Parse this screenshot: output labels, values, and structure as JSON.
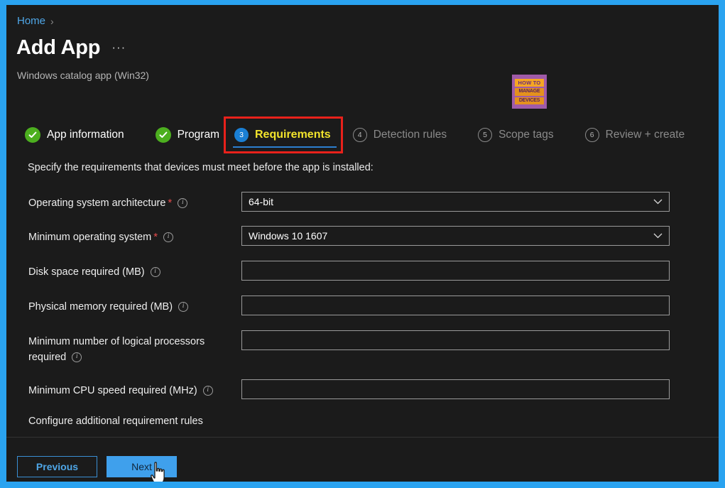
{
  "window": {
    "accent_border_color": "#2aa3f0",
    "background_color": "#1b1b1b"
  },
  "breadcrumb": {
    "home_label": "Home",
    "separator": "›"
  },
  "header": {
    "title": "Add App",
    "ellipsis": "···",
    "subtitle": "Windows catalog app (Win32)"
  },
  "watermark": {
    "line1": "HOW TO",
    "line2": "MANAGE",
    "line3": "DEVICES"
  },
  "wizard": {
    "tabs": [
      {
        "number": "1",
        "label": "App information",
        "state": "done"
      },
      {
        "number": "2",
        "label": "Program",
        "state": "done"
      },
      {
        "number": "3",
        "label": "Requirements",
        "state": "active"
      },
      {
        "number": "4",
        "label": "Detection rules",
        "state": "upcoming"
      },
      {
        "number": "5",
        "label": "Scope tags",
        "state": "upcoming"
      },
      {
        "number": "6",
        "label": "Review + create",
        "state": "upcoming"
      }
    ],
    "highlight_color": "#e8211b",
    "active_label_color": "#f2e42c"
  },
  "form": {
    "intro": "Specify the requirements that devices must meet before the app is installed:",
    "required_marker": "*",
    "info_glyph": "i",
    "chevron": "⌄",
    "fields": [
      {
        "label": "Operating system architecture",
        "required": true,
        "type": "dropdown",
        "value": "64-bit",
        "placeholder": ""
      },
      {
        "label": "Minimum operating system",
        "required": true,
        "type": "dropdown",
        "value": "Windows 10 1607",
        "placeholder": ""
      },
      {
        "label": "Disk space required (MB)",
        "required": false,
        "type": "text",
        "value": "",
        "placeholder": ""
      },
      {
        "label": "Physical memory required (MB)",
        "required": false,
        "type": "text",
        "value": "",
        "placeholder": ""
      },
      {
        "label": "Minimum number of logical processors required",
        "required": false,
        "type": "text",
        "value": "",
        "placeholder": ""
      },
      {
        "label": "Minimum CPU speed required (MHz)",
        "required": false,
        "type": "text",
        "value": "",
        "placeholder": ""
      }
    ],
    "configure_additional_label": "Configure additional requirement rules"
  },
  "footer": {
    "previous_label": "Previous",
    "next_label": "Next"
  }
}
